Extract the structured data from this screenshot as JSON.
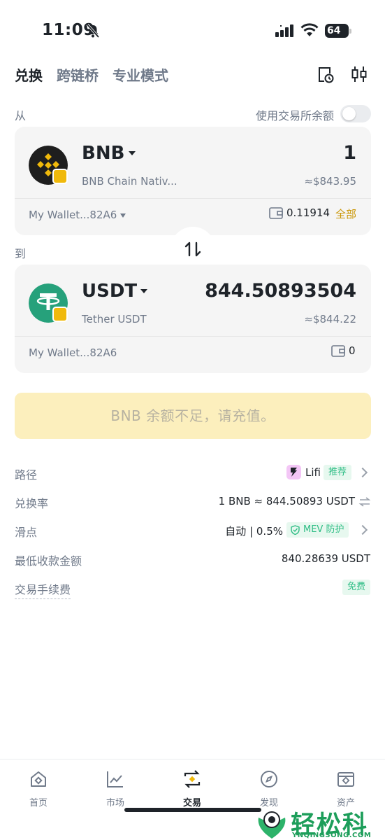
{
  "status_bar": {
    "time": "11:09",
    "battery": "64"
  },
  "tabs": [
    {
      "label": "兑换",
      "active": true
    },
    {
      "label": "跨链桥",
      "active": false
    },
    {
      "label": "专业模式",
      "active": false
    }
  ],
  "from_label": "从",
  "exchange_balance_label": "使用交易所余额",
  "exchange_balance_enabled": false,
  "from": {
    "symbol": "BNB",
    "name": "BNB Chain Nativ...",
    "amount": "1",
    "usd_value": "≈$843.95",
    "wallet": "My Wallet...82A6",
    "balance": "0.11914",
    "max_label": "全部"
  },
  "to_label": "到",
  "to": {
    "symbol": "USDT",
    "name": "Tether USDT",
    "amount": "844.50893504",
    "usd_value": "≈$844.22",
    "wallet": "My Wallet...82A6",
    "balance": "0"
  },
  "action_button": "BNB 余额不足，请充值。",
  "details": {
    "route": {
      "label": "路径",
      "provider": "Lifi",
      "tag": "推荐"
    },
    "rate": {
      "label": "兑换率",
      "value": "1 BNB ≈ 844.50893 USDT"
    },
    "slippage": {
      "label": "滑点",
      "value": "自动 | 0.5%",
      "mev_tag": "MEV 防护"
    },
    "min_received": {
      "label": "最低收款金额",
      "value": "840.28639 USDT"
    },
    "fee": {
      "label": "交易手续费",
      "tag": "免费"
    }
  },
  "nav": [
    {
      "label": "首页",
      "icon": "home-icon",
      "active": false
    },
    {
      "label": "市场",
      "icon": "market-chart-icon",
      "active": false
    },
    {
      "label": "交易",
      "icon": "trade-swap-icon",
      "active": true
    },
    {
      "label": "发现",
      "icon": "discover-compass-icon",
      "active": false
    },
    {
      "label": "资产",
      "icon": "wallet-assets-icon",
      "active": false
    }
  ],
  "watermark": {
    "title": "轻松科技",
    "subtitle": "YNQINGSONG.COM"
  },
  "colors": {
    "accent": "#F0B90B",
    "max_link": "#C99400",
    "green_tag": "#2EBD85",
    "disabled_button_bg": "#FCEFBD",
    "card_bg": "#F5F5F5"
  }
}
